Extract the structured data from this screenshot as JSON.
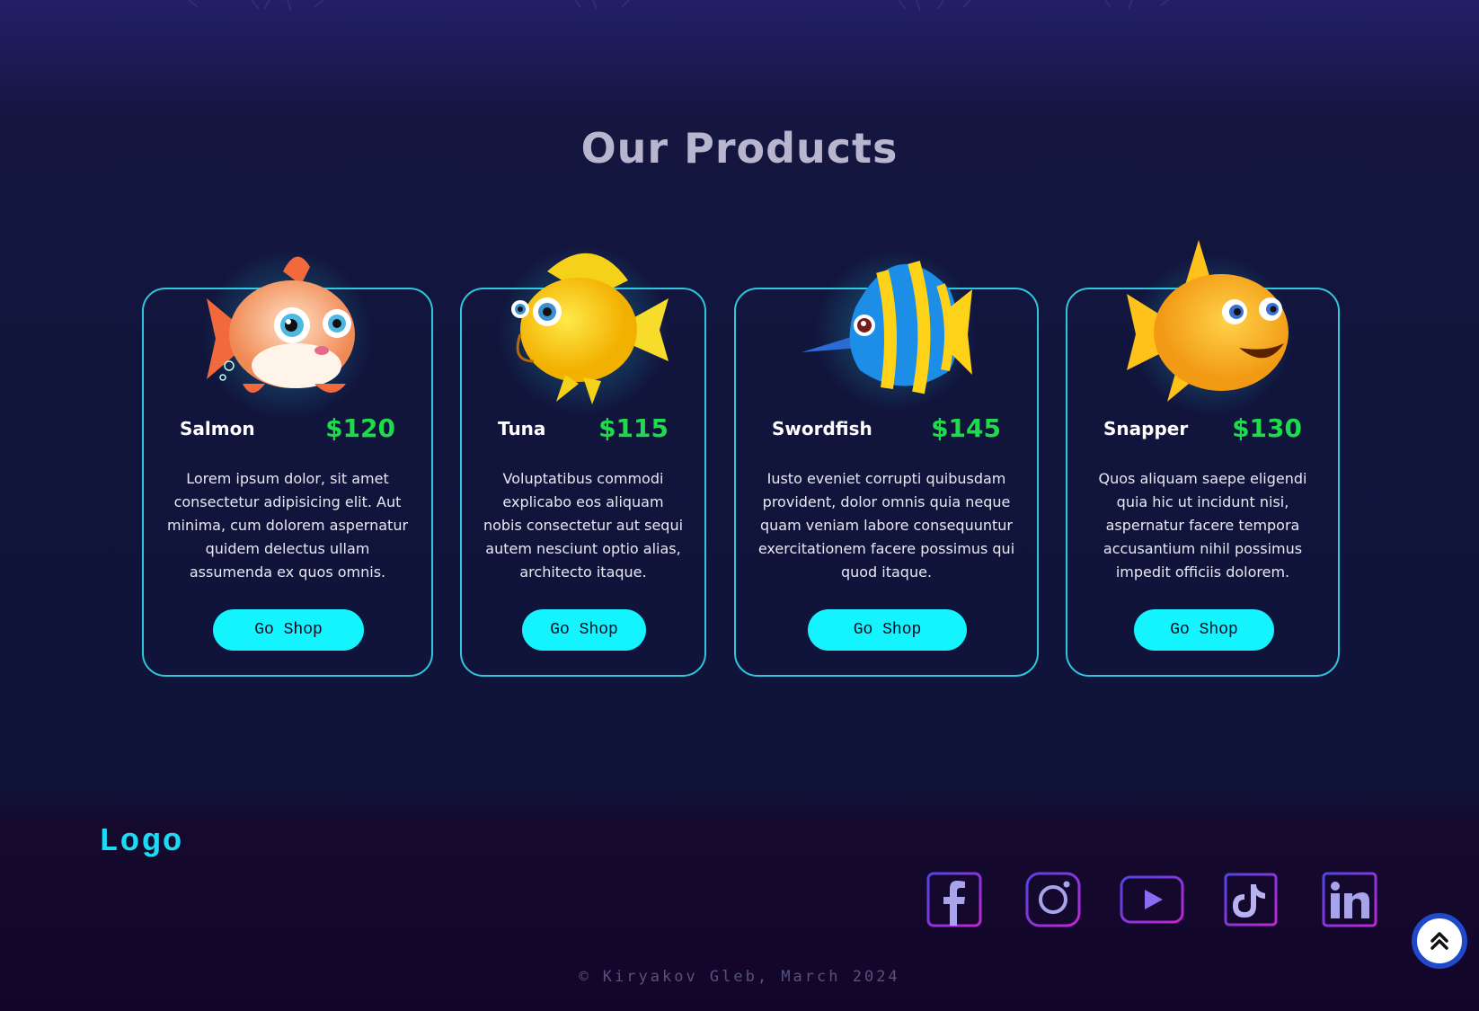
{
  "section": {
    "title": "Our Products"
  },
  "products": [
    {
      "name": "Salmon",
      "price": "$120",
      "description": "Lorem ipsum dolor, sit amet consectetur adipisicing elit. Aut minima, cum dolorem aspernatur quidem delectus ullam assumenda ex quos omnis.",
      "button_label": "Go Shop",
      "image_icon": "salmon-fish-icon"
    },
    {
      "name": "Tuna",
      "price": "$115",
      "description": "Voluptatibus commodi explicabo eos aliquam nobis consectetur aut sequi autem nesciunt optio alias, architecto itaque.",
      "button_label": "Go Shop",
      "image_icon": "tuna-fish-icon"
    },
    {
      "name": "Swordfish",
      "price": "$145",
      "description": "Iusto eveniet corrupti quibusdam provident, dolor omnis quia neque quam veniam labore consequuntur exercitationem facere possimus qui quod itaque.",
      "button_label": "Go Shop",
      "image_icon": "swordfish-icon"
    },
    {
      "name": "Snapper",
      "price": "$130",
      "description": "Quos aliquam saepe eligendi quia hic ut incidunt nisi, aspernatur facere tempora accusantium nihil possimus impedit officiis dolorem.",
      "button_label": "Go Shop",
      "image_icon": "snapper-fish-icon"
    }
  ],
  "footer": {
    "logo": "Logo",
    "social_icons": [
      "facebook-icon",
      "instagram-icon",
      "youtube-icon",
      "tiktok-icon",
      "linkedin-icon"
    ],
    "copyright": "© Kiryakov Gleb, March 2024",
    "scroll_top_icon": "chevron-double-up-icon"
  },
  "colors": {
    "accent_cyan": "#14f4ff",
    "card_border": "#2fc6de",
    "price_green": "#1ddb4a",
    "logo_cyan": "#1ddbf5",
    "social_gradient": [
      "#4f46e5",
      "#c026d3"
    ]
  }
}
